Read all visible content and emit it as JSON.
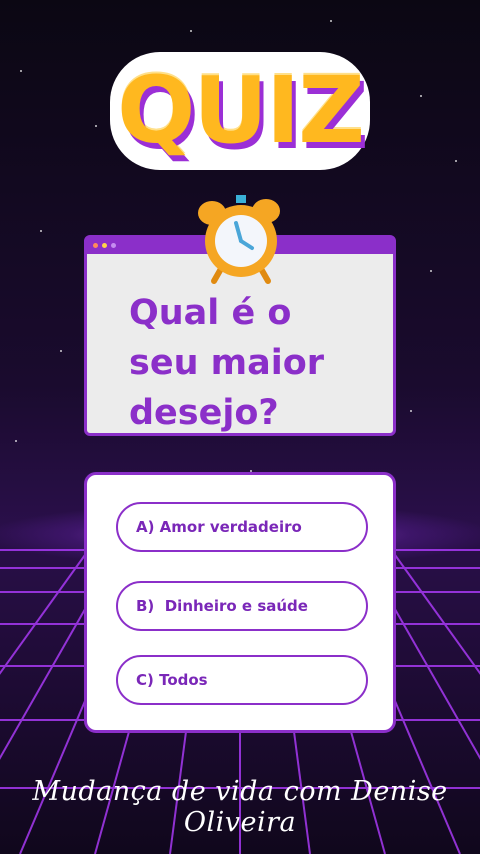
{
  "logo": {
    "text": "QUIZ"
  },
  "question_card": {
    "text": "Qual é o seu maior desejo?"
  },
  "answers": [
    {
      "label": "A) Amor verdadeiro"
    },
    {
      "label": "B)  Dinheiro e saúde"
    },
    {
      "label": "C) Todos"
    }
  ],
  "footer": {
    "signature": "Mudança de vida com Denise Oliveira"
  },
  "colors": {
    "accent": "#8b2fc9",
    "logo_fill": "#ffb81f",
    "logo_shadow": "#9b2fd6",
    "background": "#120a20",
    "card_background": "#ececec"
  },
  "icons": [
    "alarm-clock-icon",
    "window-dots-icon"
  ]
}
